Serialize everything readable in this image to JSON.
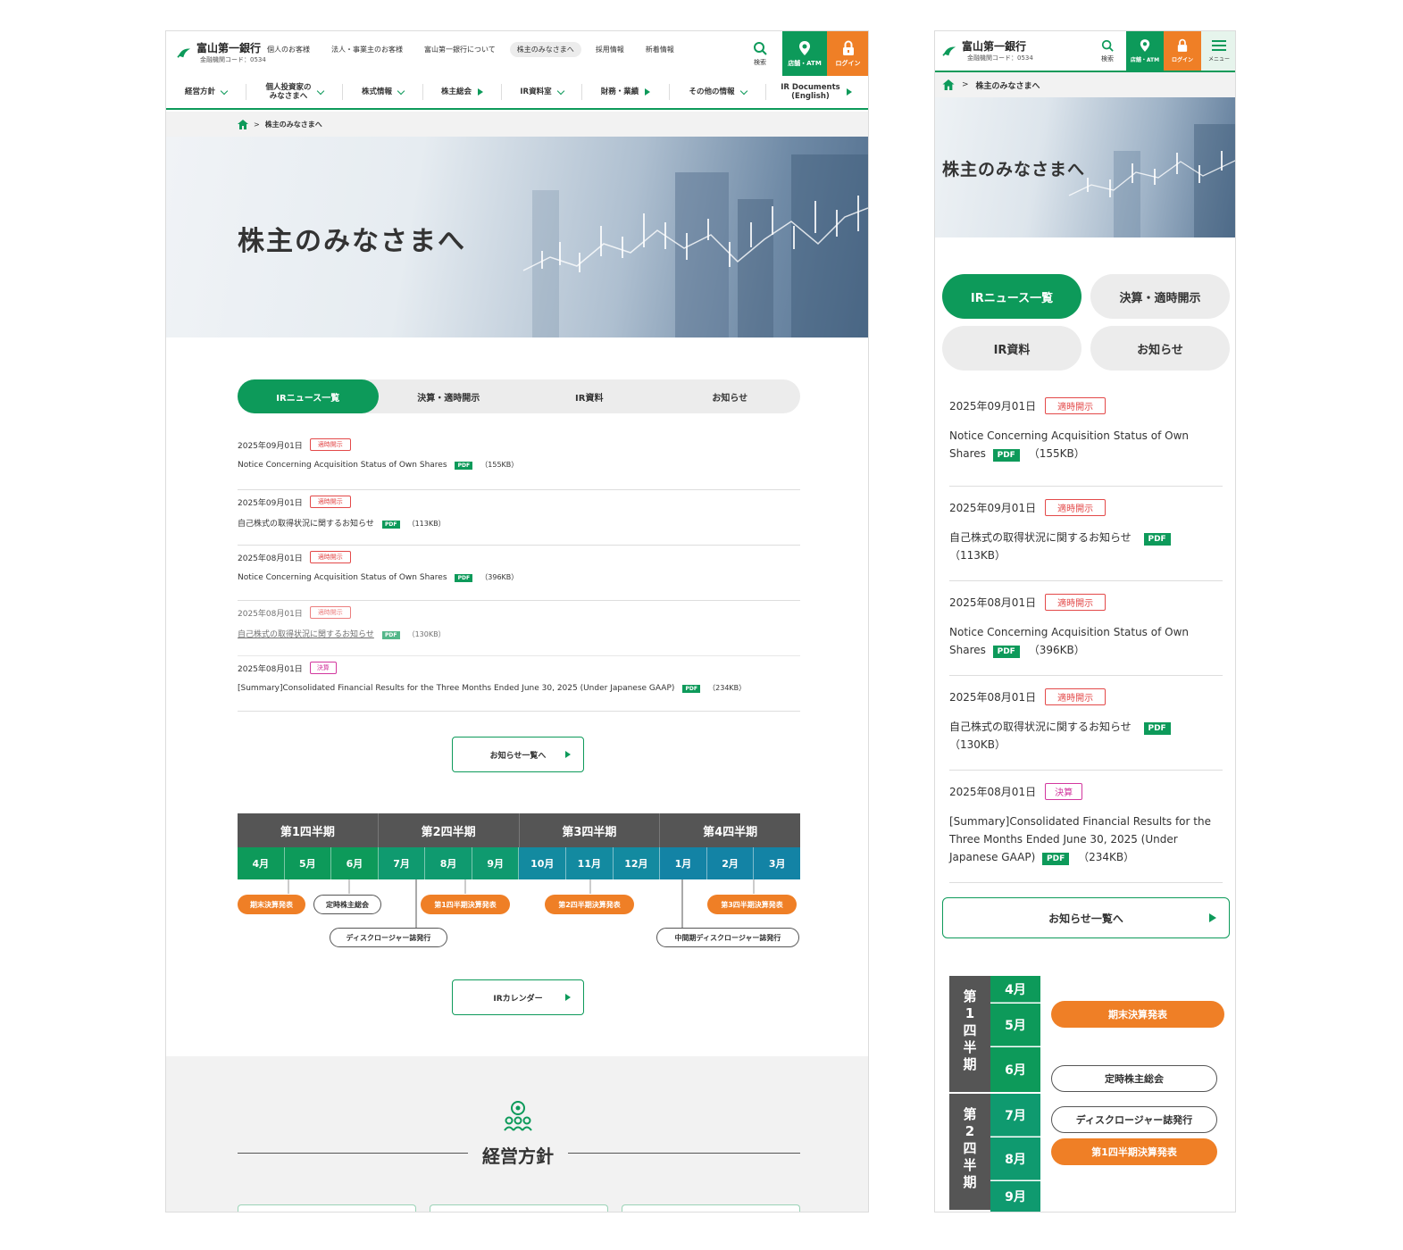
{
  "header": {
    "bank_name": "富山第一銀行",
    "bank_code": "金融機関コード：0534",
    "gnav": [
      "個人のお客様",
      "法人・事業主のお客様",
      "富山第一銀行について",
      "株主のみなさまへ",
      "採用情報",
      "新着情報"
    ],
    "search_label": "検索",
    "atm_label": "店舗・ATM",
    "login_label": "ログイン",
    "menu_label": "メニュー"
  },
  "subnav": [
    "経営方針",
    "個人投資家の\nみなさまへ",
    "株式情報",
    "株主総会",
    "IR資料室",
    "財務・業績",
    "その他の情報",
    "IR Documents\n(English)"
  ],
  "breadcrumb": {
    "separator": ">",
    "current": "株主のみなさまへ"
  },
  "hero": {
    "title": "株主のみなさまへ"
  },
  "tabs": [
    "IRニュース一覧",
    "決算・適時開示",
    "IR資料",
    "お知らせ"
  ],
  "news": [
    {
      "date": "2025年09月01日",
      "tag": "適時開示",
      "title": "Notice Concerning Acquisition Status of Own Shares",
      "pdf": "PDF",
      "size": "（155KB）"
    },
    {
      "date": "2025年09月01日",
      "tag": "適時開示",
      "title": "自己株式の取得状況に関するお知らせ",
      "pdf": "PDF",
      "size": "（113KB）"
    },
    {
      "date": "2025年08月01日",
      "tag": "適時開示",
      "title": "Notice Concerning Acquisition Status of Own Shares",
      "pdf": "PDF",
      "size": "（396KB）"
    },
    {
      "date": "2025年08月01日",
      "tag": "適時開示",
      "title": "自己株式の取得状況に関するお知らせ",
      "pdf": "PDF",
      "size": "（130KB）"
    },
    {
      "date": "2025年08月01日",
      "tag": "決算",
      "title": "[Summary]Consolidated Financial Results for the Three Months Ended June 30, 2025 (Under Japanese GAAP)",
      "pdf": "PDF",
      "size": "（234KB）"
    }
  ],
  "news_more_label": "お知らせ一覧へ",
  "calendar": {
    "quarters": [
      "第1四半期",
      "第2四半期",
      "第3四半期",
      "第4四半期"
    ],
    "quarters_vertical": [
      "第\n1\n四\n半\n期",
      "第\n2\n四\n半\n期"
    ],
    "months": [
      "4月",
      "5月",
      "6月",
      "7月",
      "8月",
      "9月",
      "10月",
      "11月",
      "12月",
      "1月",
      "2月",
      "3月"
    ],
    "events": [
      "期末決算発表",
      "定時株主総会",
      "第1四半期決算発表",
      "第2四半期決算発表",
      "第3四半期決算発表",
      "ディスクロージャー誌発行",
      "中間期ディスクロージャー誌発行"
    ],
    "button_label": "IRカレンダー"
  },
  "section": {
    "title": "経営方針"
  },
  "colors": {
    "green": "#0d9a5a",
    "orange": "#ef7f26",
    "teal": "#138aa0",
    "red_tag": "#e34949",
    "magenta_tag": "#d2379e"
  }
}
